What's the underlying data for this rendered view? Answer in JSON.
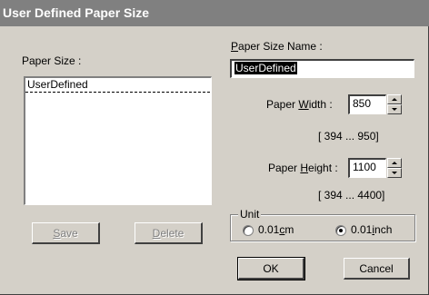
{
  "window": {
    "title": "User Defined Paper Size"
  },
  "paper_size_list": {
    "label": "Paper Size :",
    "items": [
      "UserDefined"
    ]
  },
  "paper_size_name": {
    "label_underlined": "P",
    "label_rest": "aper Size Name :",
    "value": "UserDefined"
  },
  "paper_width": {
    "label_before": "Paper ",
    "label_underlined": "W",
    "label_after": "idth  :",
    "value": "850",
    "range": "[  394 ...   950]"
  },
  "paper_height": {
    "label_before": "Paper ",
    "label_underlined": "H",
    "label_after": "eight :",
    "value": "1100",
    "range": "[  394 ... 4400]"
  },
  "unit": {
    "legend": "Unit",
    "options": [
      {
        "before": "0.01",
        "underlined": "c",
        "after": "m",
        "selected": false
      },
      {
        "before": "0.01",
        "underlined": "i",
        "after": "nch",
        "selected": true
      }
    ]
  },
  "buttons": {
    "save": {
      "underlined": "S",
      "rest": "ave",
      "enabled": false
    },
    "delete": {
      "underlined": "D",
      "rest": "elete",
      "enabled": false
    },
    "ok": {
      "label": "OK"
    },
    "cancel": {
      "label": "Cancel"
    }
  },
  "colors": {
    "dialog_face": "#d4d0c8",
    "title_bar": "#808080",
    "selection": "#000000"
  }
}
